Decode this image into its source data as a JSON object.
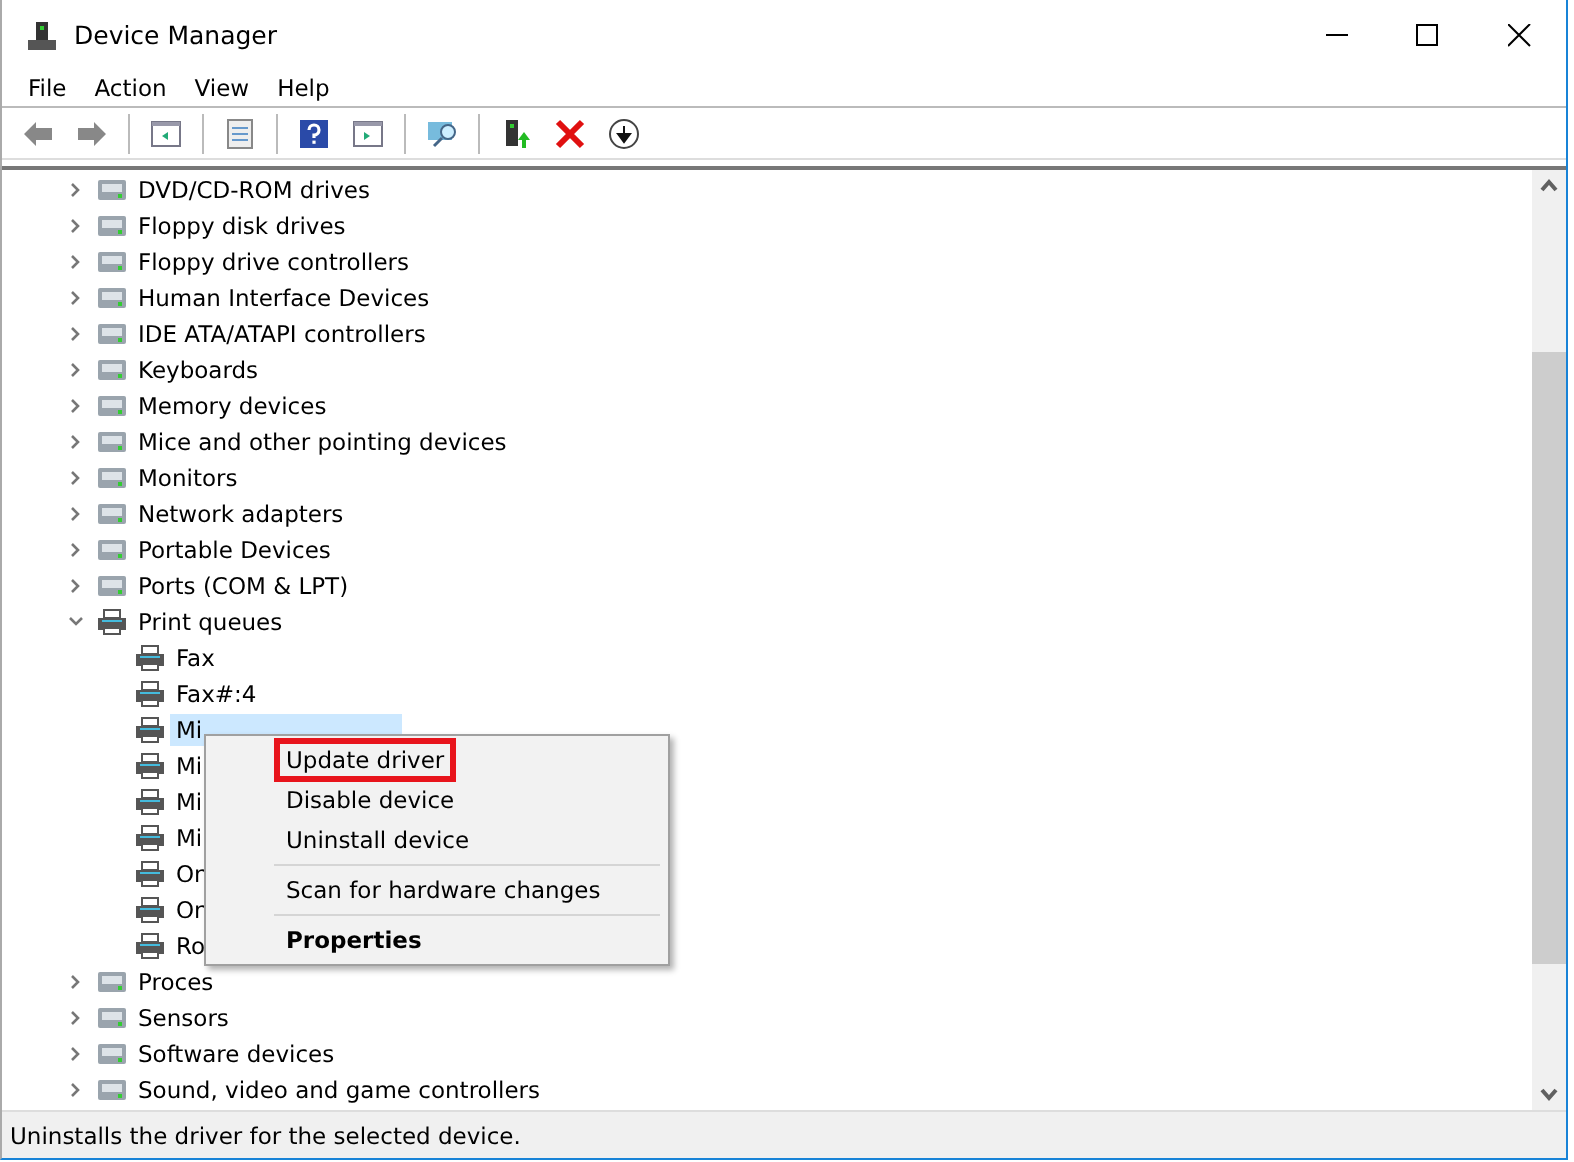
{
  "window": {
    "title": "Device Manager"
  },
  "menu": [
    "File",
    "Action",
    "View",
    "Help"
  ],
  "tree": [
    {
      "label": "DVD/CD-ROM drives",
      "expanded": false,
      "selected": false
    },
    {
      "label": "Floppy disk drives",
      "expanded": false,
      "selected": false
    },
    {
      "label": "Floppy drive controllers",
      "expanded": false,
      "selected": false
    },
    {
      "label": "Human Interface Devices",
      "expanded": false,
      "selected": false
    },
    {
      "label": "IDE ATA/ATAPI controllers",
      "expanded": false,
      "selected": false
    },
    {
      "label": "Keyboards",
      "expanded": false,
      "selected": false
    },
    {
      "label": "Memory devices",
      "expanded": false,
      "selected": false
    },
    {
      "label": "Mice and other pointing devices",
      "expanded": false,
      "selected": false
    },
    {
      "label": "Monitors",
      "expanded": false,
      "selected": false
    },
    {
      "label": "Network adapters",
      "expanded": false,
      "selected": false
    },
    {
      "label": "Portable Devices",
      "expanded": false,
      "selected": false
    },
    {
      "label": "Ports (COM & LPT)",
      "expanded": false,
      "selected": false
    },
    {
      "label": "Print queues",
      "expanded": true,
      "selected": false,
      "children": [
        {
          "label": "Fax",
          "selected": false
        },
        {
          "label": "Fax#:4",
          "selected": false
        },
        {
          "label": "Mi",
          "selected": true
        },
        {
          "label": "Mi",
          "selected": false
        },
        {
          "label": "Mi",
          "selected": false
        },
        {
          "label": "Mi",
          "selected": false
        },
        {
          "label": "On",
          "selected": false
        },
        {
          "label": "On",
          "selected": false
        },
        {
          "label": "Ro",
          "selected": false
        }
      ]
    },
    {
      "label": "Proces",
      "expanded": false,
      "selected": false
    },
    {
      "label": "Sensors",
      "expanded": false,
      "selected": false
    },
    {
      "label": "Software devices",
      "expanded": false,
      "selected": false
    },
    {
      "label": "Sound, video and game controllers",
      "expanded": false,
      "selected": false
    }
  ],
  "context_menu": [
    {
      "kind": "item",
      "label": "Update driver",
      "highlighted": true
    },
    {
      "kind": "item",
      "label": "Disable device",
      "highlighted": false
    },
    {
      "kind": "item",
      "label": "Uninstall device",
      "highlighted": false
    },
    {
      "kind": "separator"
    },
    {
      "kind": "item",
      "label": "Scan for hardware changes",
      "highlighted": false
    },
    {
      "kind": "separator"
    },
    {
      "kind": "default",
      "label": "Properties",
      "highlighted": false
    }
  ],
  "status_bar": "Uninstalls the driver for the selected device."
}
